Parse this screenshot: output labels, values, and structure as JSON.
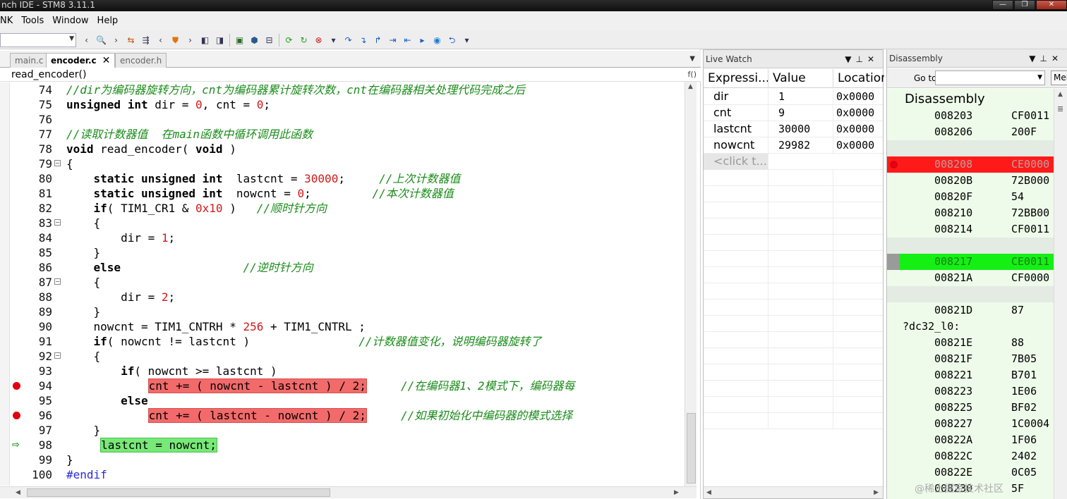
{
  "window": {
    "title": "nch IDE - STM8 3.11.1",
    "buttons": [
      "—",
      "❐",
      "✕"
    ]
  },
  "menu": [
    "NK",
    "Tools",
    "Window",
    "Help"
  ],
  "editor": {
    "tabs": [
      {
        "label": "main.c",
        "active": false
      },
      {
        "label": "encoder.c",
        "active": true,
        "close": "✕"
      },
      {
        "label": "encoder.h",
        "active": false
      }
    ],
    "function": "read_encoder()",
    "func_icon": "f()",
    "lines": [
      {
        "n": "74",
        "text": "//dir为编码器旋转方向，cnt为编码器累计旋转次数，cnt在编码器相关处理代码完成之后",
        "seg": [
          {
            "t": "//dir为编码器旋转方向，cnt为编码器累计旋转次数，cnt在编码器相关处理代码完成之后",
            "c": "cm"
          }
        ]
      },
      {
        "n": "75",
        "seg": [
          {
            "t": "unsigned int",
            "c": "kw"
          },
          {
            "t": " dir = "
          },
          {
            "t": "0",
            "c": "num"
          },
          {
            "t": ", cnt = "
          },
          {
            "t": "0",
            "c": "num"
          },
          {
            "t": ";"
          }
        ]
      },
      {
        "n": "76",
        "seg": []
      },
      {
        "n": "77",
        "seg": [
          {
            "t": "//读取计数器值  在main函数中循环调用此函数",
            "c": "cm"
          }
        ]
      },
      {
        "n": "78",
        "seg": [
          {
            "t": "void",
            "c": "kw"
          },
          {
            "t": " read_encoder( "
          },
          {
            "t": "void",
            "c": "kw"
          },
          {
            "t": " )"
          }
        ]
      },
      {
        "n": "79",
        "fold": "−",
        "seg": [
          {
            "t": "{"
          }
        ]
      },
      {
        "n": "80",
        "seg": [
          {
            "t": "    "
          },
          {
            "t": "static unsigned int",
            "c": "kw"
          },
          {
            "t": "  lastcnt = "
          },
          {
            "t": "30000",
            "c": "num"
          },
          {
            "t": ";     "
          },
          {
            "t": "//上次计数器值",
            "c": "cm"
          }
        ]
      },
      {
        "n": "81",
        "seg": [
          {
            "t": "    "
          },
          {
            "t": "static unsigned int",
            "c": "kw"
          },
          {
            "t": "  nowcnt = "
          },
          {
            "t": "0",
            "c": "num"
          },
          {
            "t": ";         "
          },
          {
            "t": "//本次计数器值",
            "c": "cm"
          }
        ]
      },
      {
        "n": "82",
        "seg": [
          {
            "t": "    "
          },
          {
            "t": "if",
            "c": "kw"
          },
          {
            "t": "( TIM1_CR1 & "
          },
          {
            "t": "0x10",
            "c": "num"
          },
          {
            "t": " )   "
          },
          {
            "t": "//顺时针方向",
            "c": "cm"
          }
        ]
      },
      {
        "n": "83",
        "fold": "−",
        "seg": [
          {
            "t": "    {"
          }
        ]
      },
      {
        "n": "84",
        "seg": [
          {
            "t": "        dir = "
          },
          {
            "t": "1",
            "c": "num"
          },
          {
            "t": ";"
          }
        ]
      },
      {
        "n": "85",
        "seg": [
          {
            "t": "    }"
          }
        ]
      },
      {
        "n": "86",
        "seg": [
          {
            "t": "    "
          },
          {
            "t": "else",
            "c": "kw"
          },
          {
            "t": "                  "
          },
          {
            "t": "//逆时针方向",
            "c": "cm"
          }
        ]
      },
      {
        "n": "87",
        "fold": "−",
        "seg": [
          {
            "t": "    {"
          }
        ]
      },
      {
        "n": "88",
        "seg": [
          {
            "t": "        dir = "
          },
          {
            "t": "2",
            "c": "num"
          },
          {
            "t": ";"
          }
        ]
      },
      {
        "n": "89",
        "seg": [
          {
            "t": "    }"
          }
        ]
      },
      {
        "n": "90",
        "seg": [
          {
            "t": "    nowcnt = TIM1_CNTRH * "
          },
          {
            "t": "256",
            "c": "num"
          },
          {
            "t": " + TIM1_CNTRL ;"
          }
        ]
      },
      {
        "n": "91",
        "seg": [
          {
            "t": "    "
          },
          {
            "t": "if",
            "c": "kw"
          },
          {
            "t": "( nowcnt != lastcnt )                "
          },
          {
            "t": "//计数器值变化，说明编码器旋转了",
            "c": "cm"
          }
        ]
      },
      {
        "n": "92",
        "fold": "−",
        "seg": [
          {
            "t": "    {"
          }
        ]
      },
      {
        "n": "93",
        "seg": [
          {
            "t": "        "
          },
          {
            "t": "if",
            "c": "kw"
          },
          {
            "t": "( nowcnt >= lastcnt )"
          }
        ]
      },
      {
        "n": "94",
        "bp": true,
        "seg": [
          {
            "t": "            "
          },
          {
            "t": "cnt += ( nowcnt - lastcnt ) / 2;",
            "c": "hl-red"
          },
          {
            "t": "     "
          },
          {
            "t": "//在编码器1、2模式下，编码器每",
            "c": "cm"
          }
        ]
      },
      {
        "n": "95",
        "seg": [
          {
            "t": "        "
          },
          {
            "t": "else",
            "c": "kw"
          }
        ]
      },
      {
        "n": "96",
        "bp": true,
        "seg": [
          {
            "t": "            "
          },
          {
            "t": "cnt += ( lastcnt - nowcnt ) / 2;",
            "c": "hl-red"
          },
          {
            "t": "     "
          },
          {
            "t": "//如果初始化中编码器的模式选择",
            "c": "cm"
          }
        ]
      },
      {
        "n": "97",
        "seg": [
          {
            "t": "    }"
          }
        ]
      },
      {
        "n": "98",
        "pc": true,
        "seg": [
          {
            "t": "     "
          },
          {
            "t": "lastcnt = nowcnt;",
            "c": "hl-green"
          }
        ]
      },
      {
        "n": "99",
        "seg": [
          {
            "t": "}"
          }
        ]
      },
      {
        "n": "100",
        "seg": [
          {
            "t": "#endif",
            "c": "pp"
          }
        ]
      }
    ]
  },
  "watch": {
    "title": "Live Watch",
    "columns": [
      "Expressi...",
      "Value",
      "Location"
    ],
    "rows": [
      {
        "expr": "dir",
        "value": "1",
        "loc": "0x0000"
      },
      {
        "expr": "cnt",
        "value": "9",
        "loc": "0x0000"
      },
      {
        "expr": "lastcnt",
        "value": "30000",
        "loc": "0x0000"
      },
      {
        "expr": "nowcnt",
        "value": "29982",
        "loc": "0x0000"
      }
    ],
    "add_placeholder": "<click t..."
  },
  "disassembly": {
    "title": "Disassembly",
    "goto_label": "Go to",
    "mem_button": "Mem",
    "heading": "Disassembly",
    "rows": [
      {
        "addr": "008203",
        "code": "CF0011",
        "kind": "normal"
      },
      {
        "addr": "008206",
        "code": "200F",
        "kind": "normal"
      },
      {
        "kind": "blank"
      },
      {
        "addr": "008208",
        "code": "CE0000",
        "kind": "breakpoint"
      },
      {
        "addr": "00820B",
        "code": "72B000",
        "kind": "normal"
      },
      {
        "addr": "00820F",
        "code": "54",
        "kind": "normal"
      },
      {
        "addr": "008210",
        "code": "72BB00",
        "kind": "normal"
      },
      {
        "addr": "008214",
        "code": "CF0011",
        "kind": "normal"
      },
      {
        "kind": "blank"
      },
      {
        "addr": "008217",
        "code": "CE0011",
        "kind": "current"
      },
      {
        "addr": "00821A",
        "code": "CF0000",
        "kind": "normal"
      },
      {
        "kind": "blank"
      },
      {
        "addr": "00821D",
        "code": "87",
        "kind": "normal"
      },
      {
        "label": "?dc32_l0:",
        "kind": "label"
      },
      {
        "addr": "00821E",
        "code": "88",
        "kind": "normal"
      },
      {
        "addr": "00821F",
        "code": "7B05",
        "kind": "normal"
      },
      {
        "addr": "008221",
        "code": "B701",
        "kind": "normal"
      },
      {
        "addr": "008223",
        "code": "1E06",
        "kind": "normal"
      },
      {
        "addr": "008225",
        "code": "BF02",
        "kind": "normal"
      },
      {
        "addr": "008227",
        "code": "1C0004",
        "kind": "normal"
      },
      {
        "addr": "00822A",
        "code": "1F06",
        "kind": "normal"
      },
      {
        "addr": "00822C",
        "code": "2402",
        "kind": "normal"
      },
      {
        "addr": "00822E",
        "code": "0C05",
        "kind": "normal"
      },
      {
        "addr": "008230",
        "code": "5F",
        "kind": "normal"
      }
    ]
  },
  "watermark": "@稀土掘金技术社区"
}
